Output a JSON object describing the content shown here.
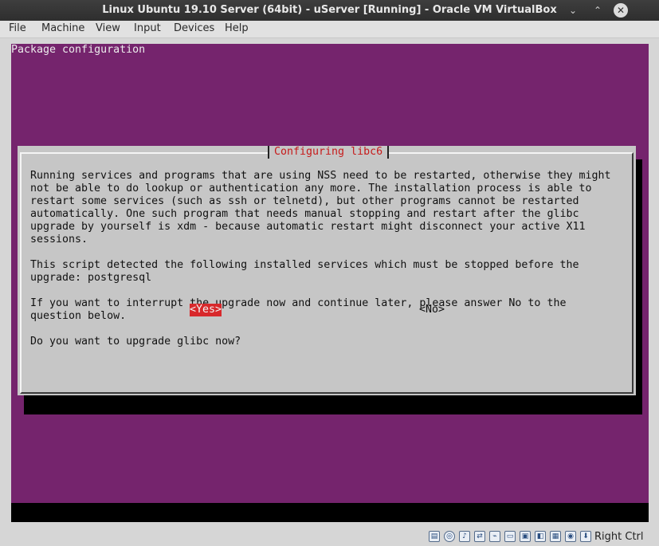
{
  "window": {
    "title": "Linux Ubuntu 19.10 Server (64bit) - uServer [Running] - Oracle VM VirtualBox",
    "minimize_glyph": "⌄",
    "maximize_glyph": "⌃",
    "close_glyph": "✕"
  },
  "menu": {
    "items": [
      "File",
      "Machine",
      "View",
      "Input",
      "Devices",
      "Help"
    ]
  },
  "console": {
    "header": "Package configuration",
    "dialog": {
      "title": "Configuring libc6",
      "body": "Running services and programs that are using NSS need to be restarted, otherwise they might\nnot be able to do lookup or authentication any more. The installation process is able to\nrestart some services (such as ssh or telnetd), but other programs cannot be restarted\nautomatically. One such program that needs manual stopping and restart after the glibc\nupgrade by yourself is xdm - because automatic restart might disconnect your active X11\nsessions.\n\nThis script detected the following installed services which must be stopped before the\nupgrade: postgresql\n\nIf you want to interrupt the upgrade now and continue later, please answer No to the\nquestion below.\n\nDo you want to upgrade glibc now?",
      "yes_label": "<Yes>",
      "no_label": "<No>",
      "selected": "<Yes>"
    }
  },
  "statusbar": {
    "host_key": "Right Ctrl",
    "icons": [
      "hard-disk-icon",
      "optical-drive-icon",
      "audio-icon",
      "network-icon",
      "usb-icon",
      "shared-folders-icon",
      "display-icon",
      "recording-icon",
      "cpu-icon",
      "mouse-integration-icon",
      "keyboard-icon"
    ]
  },
  "colors": {
    "console_background": "#75246d",
    "dialog_background": "#c6c6c6",
    "dialog_title": "#c71a1a",
    "selected_button": "#d8282b"
  }
}
